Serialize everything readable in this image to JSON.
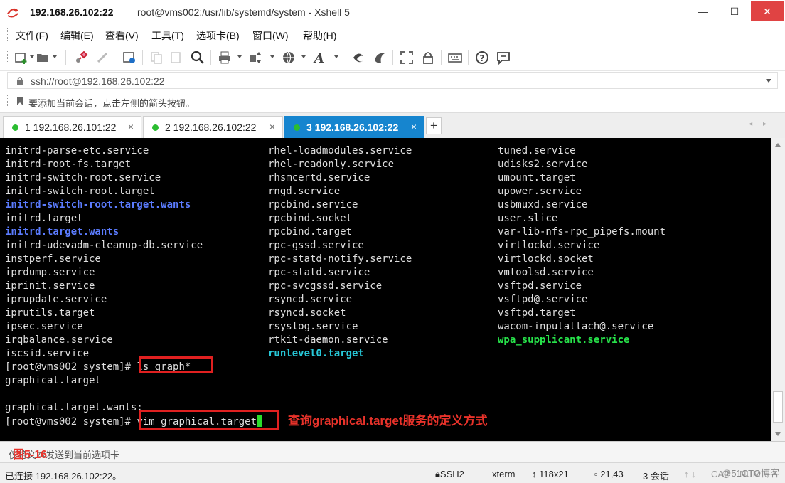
{
  "window": {
    "title_main": "192.168.26.102:22",
    "title_rest": "root@vms002:/usr/lib/systemd/system - Xshell 5",
    "minimize": "—",
    "maximize": "☐",
    "close": "✕"
  },
  "menu": [
    "文件(F)",
    "编辑(E)",
    "查看(V)",
    "工具(T)",
    "选项卡(B)",
    "窗口(W)",
    "帮助(H)"
  ],
  "address": {
    "value": "ssh://root@192.168.26.102:22"
  },
  "hint": "要添加当前会话，点击左侧的箭头按钮。",
  "tabs": [
    {
      "num": "1",
      "host": " 192.168.26.101:22",
      "active": false
    },
    {
      "num": "2",
      "host": " 192.168.26.102:22",
      "active": false
    },
    {
      "num": "3",
      "host": " 192.168.26.102:22",
      "active": true
    }
  ],
  "tab_close": "×",
  "tab_new": "+",
  "tab_nav": "◂ ▸",
  "terminal": {
    "rows": [
      [
        {
          "t": "initrd-parse-etc.service",
          "c": ""
        },
        {
          "t": "rhel-loadmodules.service",
          "c": ""
        },
        {
          "t": "tuned.service",
          "c": ""
        }
      ],
      [
        {
          "t": "initrd-root-fs.target",
          "c": ""
        },
        {
          "t": "rhel-readonly.service",
          "c": ""
        },
        {
          "t": "udisks2.service",
          "c": ""
        }
      ],
      [
        {
          "t": "initrd-switch-root.service",
          "c": ""
        },
        {
          "t": "rhsmcertd.service",
          "c": ""
        },
        {
          "t": "umount.target",
          "c": ""
        }
      ],
      [
        {
          "t": "initrd-switch-root.target",
          "c": ""
        },
        {
          "t": "rngd.service",
          "c": ""
        },
        {
          "t": "upower.service",
          "c": ""
        }
      ],
      [
        {
          "t": "initrd-switch-root.target.wants",
          "c": "dir"
        },
        {
          "t": "rpcbind.service",
          "c": ""
        },
        {
          "t": "usbmuxd.service",
          "c": ""
        }
      ],
      [
        {
          "t": "initrd.target",
          "c": ""
        },
        {
          "t": "rpcbind.socket",
          "c": ""
        },
        {
          "t": "user.slice",
          "c": ""
        }
      ],
      [
        {
          "t": "initrd.target.wants",
          "c": "dir"
        },
        {
          "t": "rpcbind.target",
          "c": ""
        },
        {
          "t": "var-lib-nfs-rpc_pipefs.mount",
          "c": ""
        }
      ],
      [
        {
          "t": "initrd-udevadm-cleanup-db.service",
          "c": ""
        },
        {
          "t": "rpc-gssd.service",
          "c": ""
        },
        {
          "t": "virtlockd.service",
          "c": ""
        }
      ],
      [
        {
          "t": "instperf.service",
          "c": ""
        },
        {
          "t": "rpc-statd-notify.service",
          "c": ""
        },
        {
          "t": "virtlockd.socket",
          "c": ""
        }
      ],
      [
        {
          "t": "iprdump.service",
          "c": ""
        },
        {
          "t": "rpc-statd.service",
          "c": ""
        },
        {
          "t": "vmtoolsd.service",
          "c": ""
        }
      ],
      [
        {
          "t": "iprinit.service",
          "c": ""
        },
        {
          "t": "rpc-svcgssd.service",
          "c": ""
        },
        {
          "t": "vsftpd.service",
          "c": ""
        }
      ],
      [
        {
          "t": "iprupdate.service",
          "c": ""
        },
        {
          "t": "rsyncd.service",
          "c": ""
        },
        {
          "t": "vsftpd@.service",
          "c": ""
        }
      ],
      [
        {
          "t": "iprutils.target",
          "c": ""
        },
        {
          "t": "rsyncd.socket",
          "c": ""
        },
        {
          "t": "vsftpd.target",
          "c": ""
        }
      ],
      [
        {
          "t": "ipsec.service",
          "c": ""
        },
        {
          "t": "rsyslog.service",
          "c": ""
        },
        {
          "t": "wacom-inputattach@.service",
          "c": ""
        }
      ],
      [
        {
          "t": "irqbalance.service",
          "c": ""
        },
        {
          "t": "rtkit-daemon.service",
          "c": ""
        },
        {
          "t": "wpa_supplicant.service",
          "c": "exe"
        }
      ],
      [
        {
          "t": "iscsid.service",
          "c": ""
        },
        {
          "t": "runlevel0.target",
          "c": "link"
        },
        {
          "t": "",
          "c": ""
        }
      ]
    ],
    "prompt": "[root@vms002 system]# ",
    "cmd1": "ls graph*",
    "out1": "graphical.target",
    "out2": "graphical.target.wants:",
    "cmd2": "vim graphical.target"
  },
  "annotation": "查询graphical.target服务的定义方式",
  "figure_label": "图5-16",
  "send_bar": "仅将文本发送到当前选项卡",
  "status": {
    "connection": "已连接 192.168.26.102:22。",
    "protocol": "SSH2",
    "term": "xterm",
    "size": "118x21",
    "position": "21,43",
    "sessions": "3 会话",
    "caps": "CAP",
    "num": "NUM"
  },
  "watermark": "@51CTO博客",
  "colors": {
    "tab_active": "#1685cf",
    "terminal_bg": "#000000",
    "annotation_red": "#e8322a",
    "dir_blue": "#5b7cff",
    "exe_green": "#27e24a",
    "link_cyan": "#27c8d8"
  }
}
